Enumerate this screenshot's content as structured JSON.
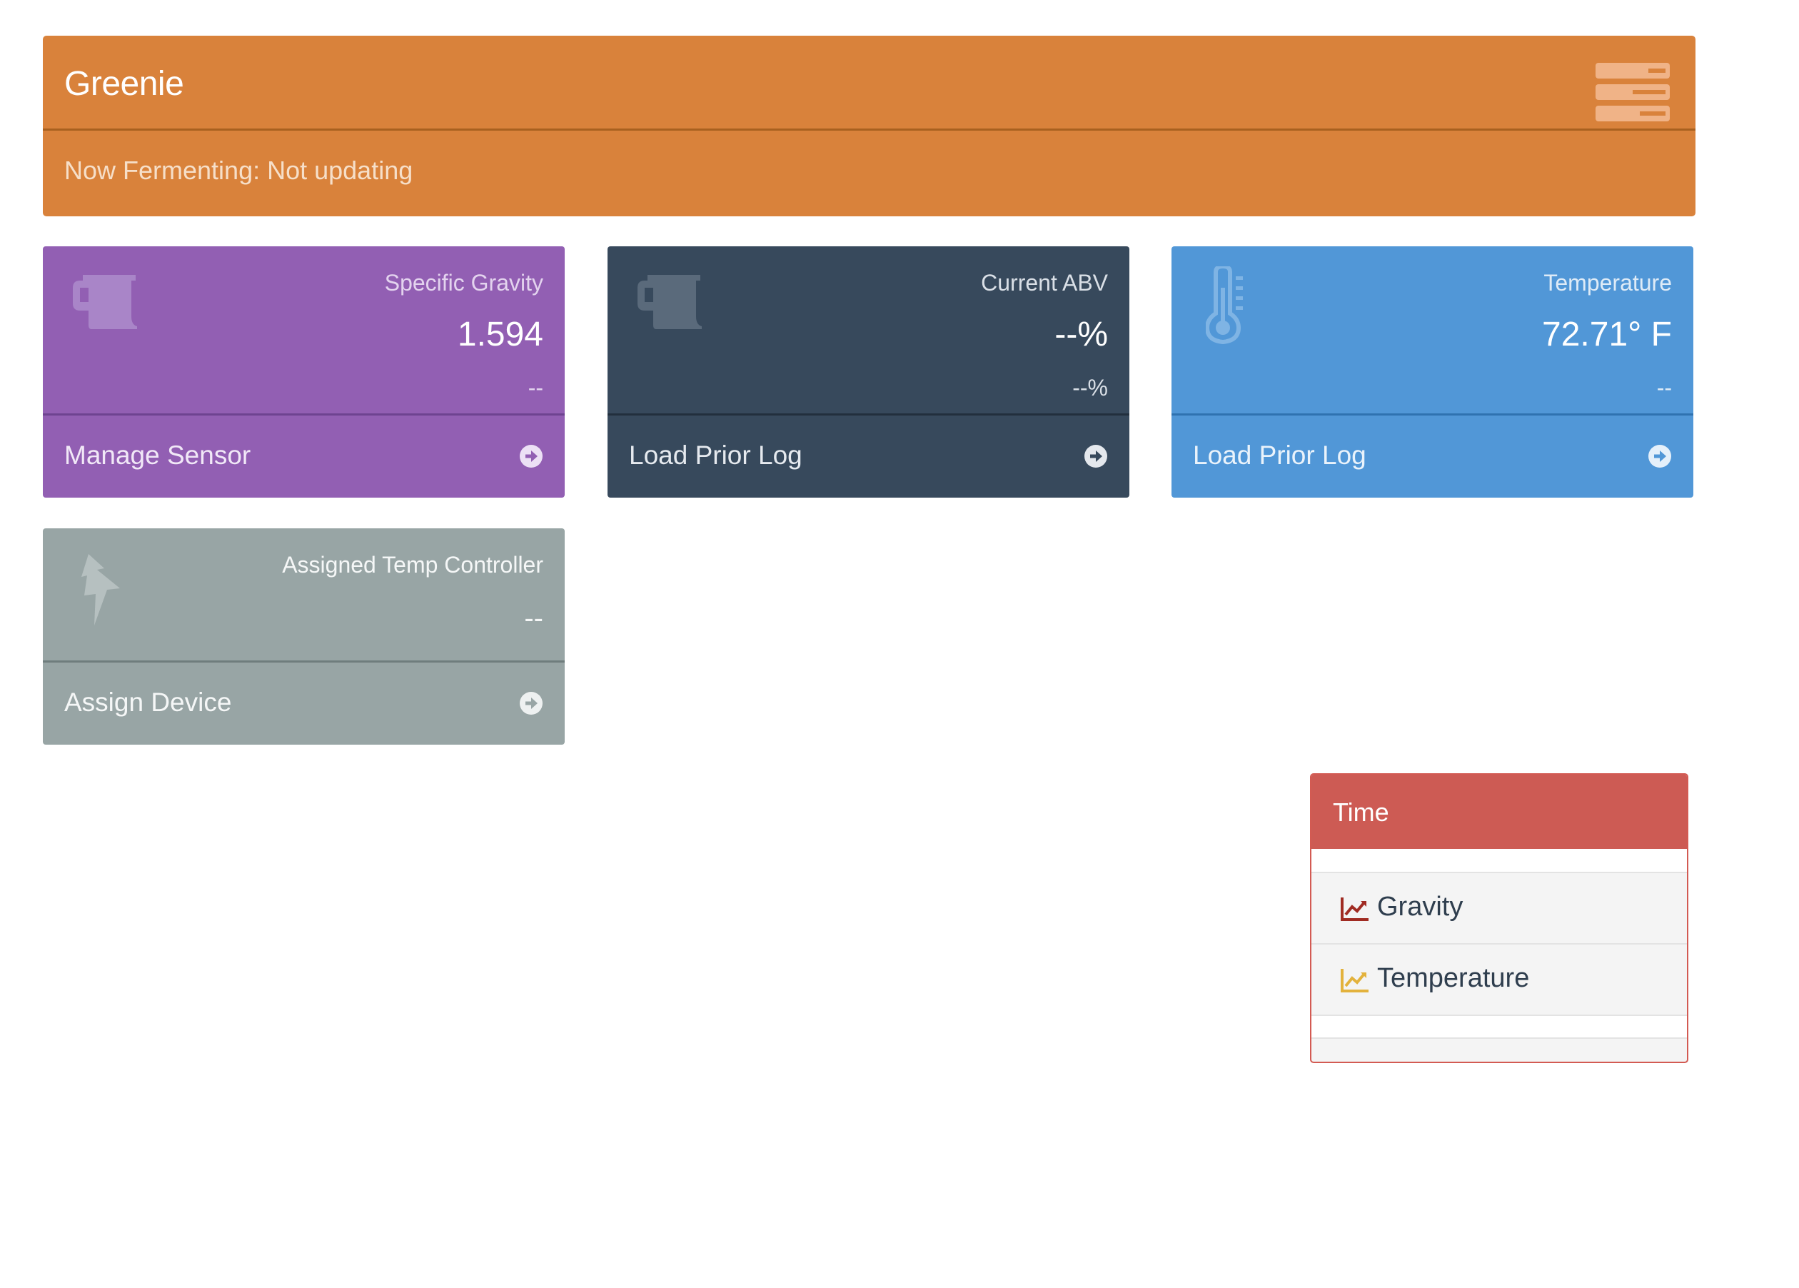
{
  "header": {
    "title": "Greenie",
    "status": "Now Fermenting: Not updating",
    "menu_icon": "server-stack-icon",
    "color": "#d9823b"
  },
  "cards": {
    "gravity": {
      "title": "Specific Gravity",
      "value": "1.594",
      "sub": "--",
      "footer": "Manage Sensor",
      "icon": "beer-mug-icon",
      "color": "#925fb3"
    },
    "abv": {
      "title": "Current ABV",
      "value": "--%",
      "sub": "--%",
      "footer": "Load Prior Log",
      "icon": "beer-mug-icon",
      "color": "#37495c"
    },
    "temperature": {
      "title": "Temperature",
      "value": "72.71° F",
      "sub": "--",
      "footer": "Load Prior Log",
      "icon": "thermometer-icon",
      "color": "#5197d7"
    },
    "controller": {
      "title": "Assigned Temp Controller",
      "sub": "--",
      "footer": "Assign Device",
      "icon": "lightning-bolt-icon",
      "color": "#98a5a5"
    }
  },
  "legend": {
    "title": "Time",
    "items": [
      {
        "label": "Gravity",
        "icon": "line-chart-icon",
        "color": "#a02b22"
      },
      {
        "label": "Temperature",
        "icon": "line-chart-icon",
        "color": "#e3b23c"
      }
    ],
    "color": "#cd5b54"
  }
}
